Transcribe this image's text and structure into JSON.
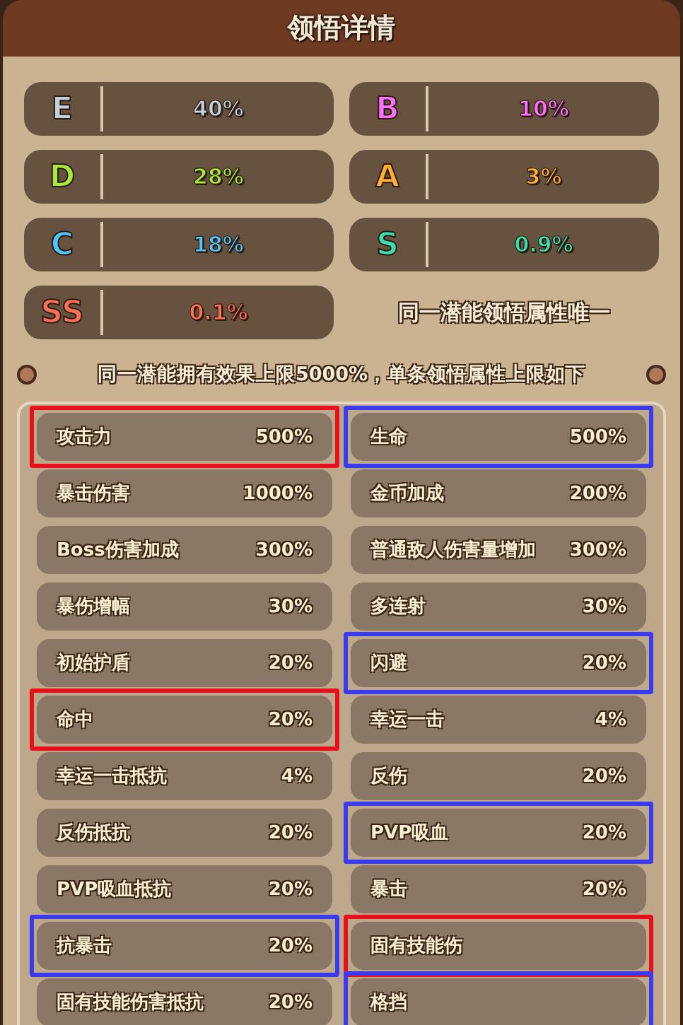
{
  "title": "领悟详情",
  "grades": [
    {
      "letter": "E",
      "color": "#c4d0e0",
      "value": "40%"
    },
    {
      "letter": "B",
      "color": "#ff70ff",
      "value": "10%"
    },
    {
      "letter": "D",
      "color": "#a8e838",
      "value": "28%"
    },
    {
      "letter": "A",
      "color": "#ffb030",
      "value": "3%"
    },
    {
      "letter": "C",
      "color": "#50c4ff",
      "value": "18%"
    },
    {
      "letter": "S",
      "color": "#38e0b0",
      "value": "0.9%"
    },
    {
      "letter": "SS",
      "color": "#ff7058",
      "value": "0.1%"
    }
  ],
  "unique_note": "同一潜能领悟属性唯一",
  "limit_note": "同一潜能拥有效果上限5000%，单条领悟属性上限如下",
  "attributes": [
    {
      "name": "攻击力",
      "value": "500%",
      "color": "#e8101c"
    },
    {
      "name": "生命",
      "value": "500%",
      "color": "#3a3af0"
    },
    {
      "name": "暴击伤害",
      "value": "1000%"
    },
    {
      "name": "金币加成",
      "value": "200%"
    },
    {
      "name": "Boss伤害加成",
      "value": "300%"
    },
    {
      "name": "普通敌人伤害量增加",
      "value": "300%"
    },
    {
      "name": "暴伤增幅",
      "value": "30%"
    },
    {
      "name": "多连射",
      "value": "30%"
    },
    {
      "name": "初始护盾",
      "value": "20%"
    },
    {
      "name": "闪避",
      "value": "20%",
      "color": "#3a3af0"
    },
    {
      "name": "命中",
      "value": "20%",
      "color": "#e8101c"
    },
    {
      "name": "幸运一击",
      "value": "4%"
    },
    {
      "name": "幸运一击抵抗",
      "value": "4%"
    },
    {
      "name": "反伤",
      "value": "20%"
    },
    {
      "name": "反伤抵抗",
      "value": "20%"
    },
    {
      "name": "PVP吸血",
      "value": "20%",
      "color": "#3a3af0"
    },
    {
      "name": "PVP吸血抵抗",
      "value": "20%"
    },
    {
      "name": "暴击",
      "value": "20%"
    },
    {
      "name": "抗暴击",
      "value": "20%",
      "color": "#3a3af0"
    },
    {
      "name": "固有技能伤",
      "color": "#e8101c"
    },
    {
      "name": "固有技能伤害抵抗",
      "value": "20%"
    },
    {
      "name": "格挡",
      "color": "#3a3af0"
    }
  ]
}
